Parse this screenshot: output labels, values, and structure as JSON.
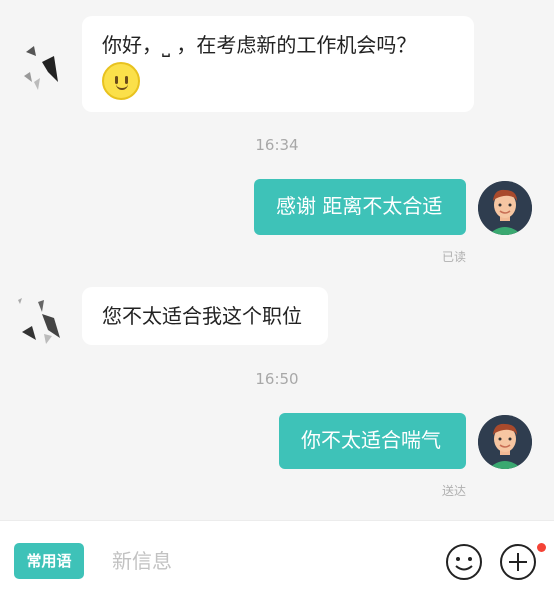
{
  "messages": [
    {
      "direction": "incoming",
      "text": "你好，⎵ ，在考虑新的工作机会吗？",
      "emoji": "smiley-emoji"
    },
    {
      "time": "16:34"
    },
    {
      "direction": "outgoing",
      "text": "感谢 距离不太合适",
      "status": "已读"
    },
    {
      "direction": "incoming",
      "text": "您不太适合我这个职位"
    },
    {
      "time": "16:50"
    },
    {
      "direction": "outgoing",
      "text": "你不太适合喘气",
      "status": "送达"
    }
  ],
  "bottom_bar": {
    "quick_phrase_label": "常用语",
    "input_placeholder": "新信息",
    "emoji_icon": "smiley-icon",
    "add_icon": "plus-circle-icon"
  },
  "colors": {
    "accent": "#3ec2b8",
    "background": "#f5f5f5",
    "notification_dot": "#f44336"
  }
}
